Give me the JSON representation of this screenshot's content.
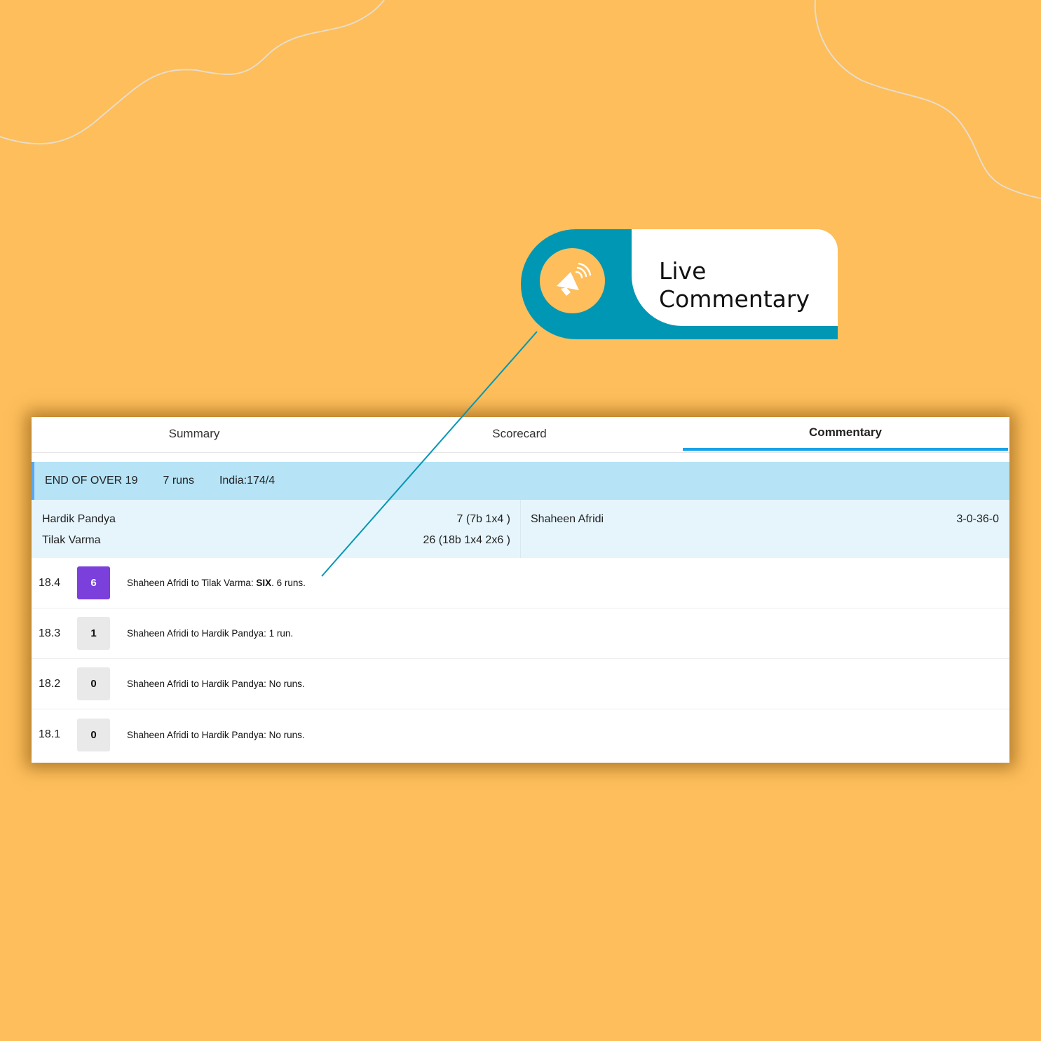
{
  "callout": {
    "title_line1": "Live",
    "title_line2": "Commentary",
    "icon": "megaphone-icon"
  },
  "colors": {
    "background": "#FDBE5B",
    "accent_teal": "#0097B4",
    "tab_underline": "#1aa3e8",
    "over_header_bg": "#B6E3F5",
    "stats_bg": "#E6F5FC",
    "six_badge": "#7b3fdc"
  },
  "tabs": [
    {
      "label": "Summary",
      "active": false
    },
    {
      "label": "Scorecard",
      "active": false
    },
    {
      "label": "Commentary",
      "active": true
    }
  ],
  "over_summary": {
    "title": "END OF OVER 19",
    "runs": "7 runs",
    "score": "India:174/4"
  },
  "batters": [
    {
      "name": "Hardik Pandya",
      "stats": "7 (7b 1x4 )"
    },
    {
      "name": "Tilak Varma",
      "stats": "26 (18b 1x4 2x6 )"
    }
  ],
  "bowler": {
    "name": "Shaheen Afridi",
    "figures": "3-0-36-0"
  },
  "balls": [
    {
      "over": "18.4",
      "result": "6",
      "prefix": "Shaheen Afridi to Tilak Varma: ",
      "highlight": "SIX",
      "suffix": ". 6 runs.",
      "type": "six"
    },
    {
      "over": "18.3",
      "result": "1",
      "prefix": "Shaheen Afridi to Hardik Pandya: 1 run.",
      "highlight": "",
      "suffix": "",
      "type": "run"
    },
    {
      "over": "18.2",
      "result": "0",
      "prefix": "Shaheen Afridi to Hardik Pandya: No runs.",
      "highlight": "",
      "suffix": "",
      "type": "dot"
    },
    {
      "over": "18.1",
      "result": "0",
      "prefix": "Shaheen Afridi to Hardik Pandya: No runs.",
      "highlight": "",
      "suffix": "",
      "type": "dot"
    }
  ]
}
